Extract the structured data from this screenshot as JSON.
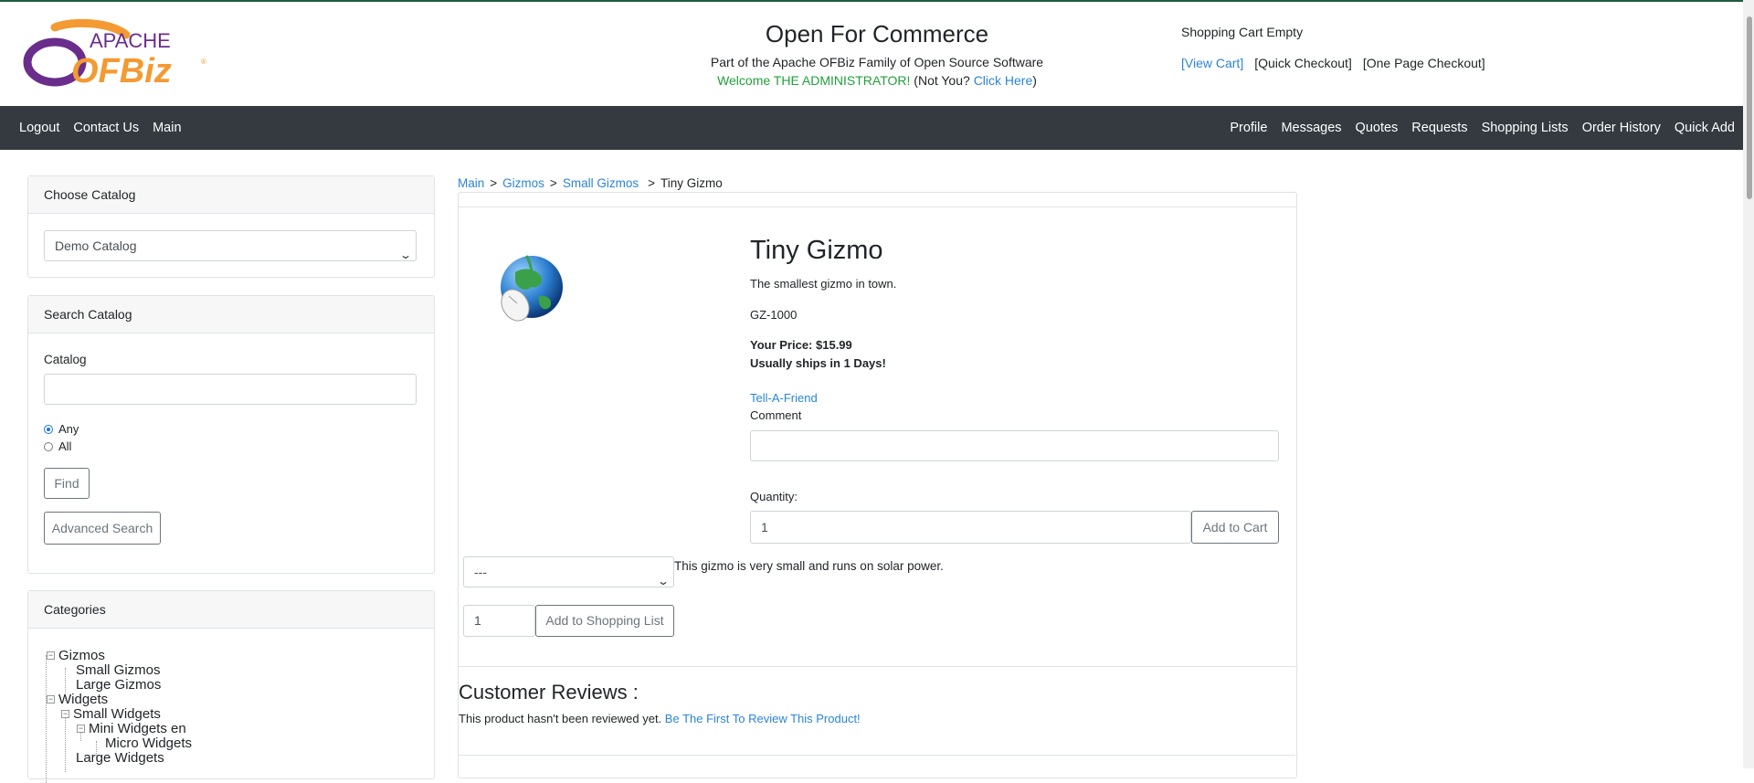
{
  "header": {
    "title": "Open For Commerce",
    "subtitle": "Part of the Apache OFBiz Family of Open Source Software",
    "welcome_text": "Welcome THE ADMINISTRATOR!",
    "not_you": "(Not You?",
    "click_here": "Click Here",
    "close_paren": ")",
    "logo": {
      "line1": "APACHE",
      "line2": "OFBiz",
      "reg": "®"
    }
  },
  "cart": {
    "status": "Shopping Cart Empty",
    "view_cart": "[View Cart]",
    "quick_checkout": "[Quick Checkout]",
    "one_page_checkout": "[One Page Checkout]"
  },
  "nav": {
    "left": [
      "Logout",
      "Contact Us",
      "Main"
    ],
    "right": [
      "Profile",
      "Messages",
      "Quotes",
      "Requests",
      "Shopping Lists",
      "Order History",
      "Quick Add"
    ]
  },
  "sidebar": {
    "choose_catalog": {
      "title": "Choose Catalog",
      "selected": "Demo Catalog"
    },
    "search_catalog": {
      "title": "Search Catalog",
      "catalog_label": "Catalog",
      "catalog_value": "",
      "radio_any": "Any",
      "radio_all": "All",
      "find_label": "Find",
      "advanced_label": "Advanced Search"
    },
    "categories": {
      "title": "Categories",
      "items": [
        "Gizmos",
        "Small Gizmos",
        "Large Gizmos",
        "Widgets",
        "Small Widgets",
        "Mini Widgets en",
        "Micro Widgets",
        "Large Widgets"
      ]
    }
  },
  "breadcrumb": {
    "items": [
      "Main",
      "Gizmos",
      "Small Gizmos"
    ],
    "separator": ">",
    "current": "Tiny Gizmo"
  },
  "product": {
    "name": "Tiny Gizmo",
    "short_desc": "The smallest gizmo in town.",
    "sku": "GZ-1000",
    "price": "Your Price: $15.99",
    "ships": "Usually ships in 1 Days!",
    "tell_a_friend": "Tell-A-Friend",
    "comment_label": "Comment",
    "comment_value": "",
    "quantity_label": "Quantity:",
    "quantity_value": "1",
    "add_to_cart": "Add to Cart",
    "list_select": "---",
    "long_desc": "This gizmo is very small and runs on solar power.",
    "list_qty": "1",
    "add_to_list": "Add to Shopping List"
  },
  "reviews": {
    "title": "Customer Reviews :",
    "text": "This product hasn't been reviewed yet.",
    "link": "Be The First To Review This Product!"
  },
  "colors": {
    "link": "#2b84d6",
    "nav_bg": "#343a40",
    "welcome": "#21a03a",
    "logo_orange": "#f39a32",
    "logo_purple": "#6a2d8c"
  }
}
